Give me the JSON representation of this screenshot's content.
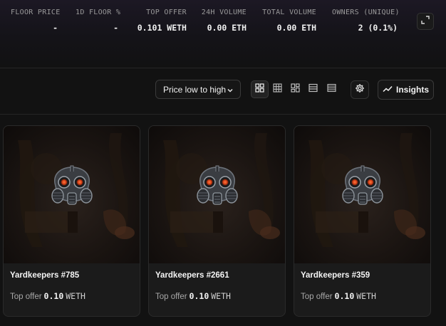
{
  "stats": [
    {
      "label": "FLOOR PRICE",
      "value": "-"
    },
    {
      "label": "1D FLOOR %",
      "value": "-"
    },
    {
      "label": "TOP OFFER",
      "value": "0.101 WETH"
    },
    {
      "label": "24H VOLUME",
      "value": "0.00 ETH"
    },
    {
      "label": "TOTAL VOLUME",
      "value": "0.00 ETH"
    },
    {
      "label": "OWNERS (UNIQUE)",
      "value": "2 (0.1%)"
    }
  ],
  "icons": {
    "expand": "expand-icon",
    "sort_chevron": "chevron-down-icon",
    "settings": "gear-icon",
    "insights": "trend-line-icon"
  },
  "toolbar": {
    "sort_label": "Price low to high",
    "view_modes": [
      "grid-large",
      "grid-small",
      "grid-mixed",
      "list",
      "table"
    ],
    "active_view": "grid-large",
    "insights_label": "Insights"
  },
  "items": [
    {
      "name": "Yardkeepers #785",
      "offer_label": "Top offer",
      "offer_value": "0.10",
      "offer_currency": "WETH"
    },
    {
      "name": "Yardkeepers #2661",
      "offer_label": "Top offer",
      "offer_value": "0.10",
      "offer_currency": "WETH"
    },
    {
      "name": "Yardkeepers #359",
      "offer_label": "Top offer",
      "offer_value": "0.10",
      "offer_currency": "WETH"
    }
  ],
  "colors": {
    "background": "#121212",
    "card": "#1b1b1b",
    "border": "#2a2a2a",
    "gasmask_eye": "#e0562b"
  }
}
